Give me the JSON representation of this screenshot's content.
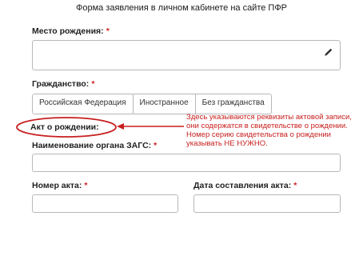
{
  "page": {
    "title": "Форма заявления в личном кабинете на сайте ПФР"
  },
  "birthplace": {
    "label": "Место рождения:",
    "required_mark": "*",
    "value": "",
    "edit_icon": "pencil-icon"
  },
  "citizenship": {
    "label": "Гражданство:",
    "required_mark": "*",
    "options": [
      "Российская Федерация",
      "Иностранное",
      "Без гражданства"
    ]
  },
  "birth_act": {
    "section_label": "Акт о рождении:"
  },
  "registry_office": {
    "label": "Наименование органа ЗАГС:",
    "required_mark": "*",
    "value": ""
  },
  "act_number": {
    "label": "Номер акта:",
    "required_mark": "*",
    "value": ""
  },
  "act_date": {
    "label": "Дата составления акта:",
    "required_mark": "*",
    "value": ""
  },
  "annotation": {
    "lines": [
      "Здесь указываются реквизиты актовой записи,",
      "они содержатся в свидетельстве о рождении.",
      "Номер серию свидетельства о рождении",
      "указывать НЕ НУЖНО."
    ],
    "color": "#c81e1e"
  }
}
